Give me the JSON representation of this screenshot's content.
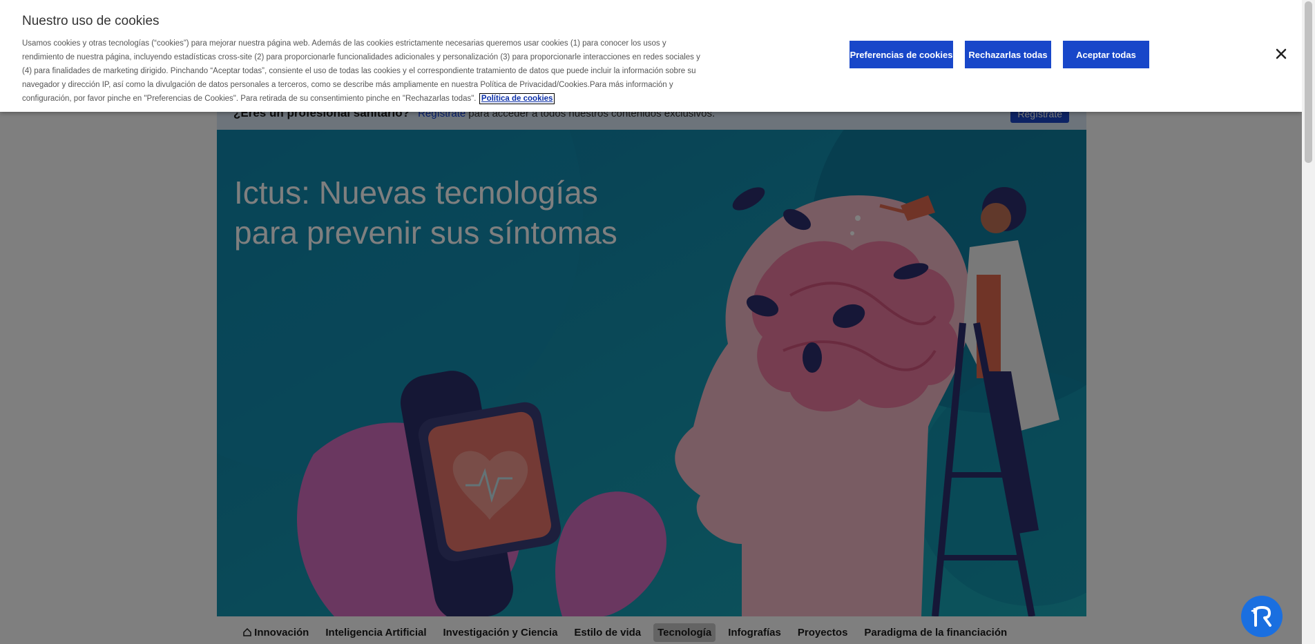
{
  "cookie_banner": {
    "title": "Nuestro uso de cookies",
    "text": "Usamos cookies y otras tecnologías (“cookies”) para mejorar nuestra página web. Además de las cookies estrictamente necesarias queremos usar cookies (1) para conocer los usos y rendimiento de nuestra página, incluyendo estadísticas cross-site (2) para proporcionarle funcionalidades adicionales y personalización (3) para proporcionarle interacciones en redes sociales y (4) para finalidades de marketing dirigido. Pinchando “Aceptar todas”, consiente el uso de todas las cookies y el correspondiente tratamiento de datos que puede incluir la información sobre su navegador y dirección IP, así como la divulgación de datos personales a terceros, como se describe más ampliamente en nuestra Política de Privacidad/Cookies.Para más información y configuración, por favor pinche en \"Preferencias de Cookies\". Para retirada de su consentimiento pinche en \"Rechazarlas todas\".",
    "link_label": "Política de cookies",
    "preferences_label": "Preferencias de cookies",
    "reject_label": "Rechazarlas todas",
    "accept_label": "Aceptar todas",
    "close_icon": "close-icon"
  },
  "register_bar": {
    "question": "¿Eres un profesional sanitario?",
    "link": "Regístrate",
    "text": "para acceder a todos nuestros contenidos exclusivos.",
    "button": "Regístrate"
  },
  "hero": {
    "title": "Ictus: Nuevas tecnologías para prevenir sus síntomas"
  },
  "nav": {
    "items": [
      "Innovación",
      "Inteligencia Artificial",
      "Investigación y Ciencia",
      "Estilo de vida",
      "Tecnología",
      "Infografías",
      "Proyectos",
      "Paradigma de la financiación"
    ],
    "active": "Tecnología",
    "home_icon": "home-icon"
  },
  "colors": {
    "primary_button": "#1847c9",
    "hero_background": "#1598b4"
  }
}
